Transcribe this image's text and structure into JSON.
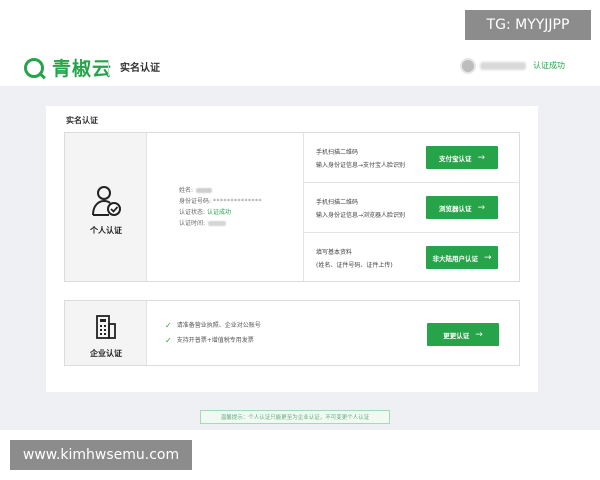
{
  "header": {
    "logo_text": "青椒云",
    "title": "实名认证",
    "user_status": "认证成功"
  },
  "card": {
    "title": "实名认证"
  },
  "personal": {
    "label": "个人认证",
    "info": {
      "name_label": "姓名:",
      "id_label": "身份证号码:",
      "id_masked": "**************",
      "status_label": "认证状态:",
      "status_value": "认证成功",
      "time_label": "认证时间:"
    },
    "methods": [
      {
        "line1": "手机扫描二维码",
        "line2": "输入身份证信息→支付宝人脸识别",
        "button": "支付宝认证"
      },
      {
        "line1": "手机扫描二维码",
        "line2": "输入身份证信息→浏览器人脸识别",
        "button": "浏览器认证"
      },
      {
        "line1": "填写基本资料",
        "line2": "(姓名、证件号码、证件上传)",
        "button": "非大陆用户认证"
      }
    ]
  },
  "enterprise": {
    "label": "企业认证",
    "items": [
      "请准备营业执照、企业对公账号",
      "支持开普票+增值税专用发票"
    ],
    "button": "更更认证"
  },
  "tip": "温馨提示：个人认证只能更至为企业认证，不可变更个人认证",
  "watermarks": {
    "tg": "TG: MYYJJPP",
    "url": "www.kimhwsemu.com"
  },
  "colors": {
    "accent": "#27a44a",
    "background": "#eef0f3"
  }
}
